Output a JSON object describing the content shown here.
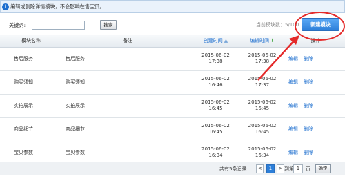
{
  "notice": {
    "icon": "info-icon",
    "text": "编辑或删除详情模块，不会影响在售宝贝。"
  },
  "toolbar": {
    "keyword_label": "关键词:",
    "keyword_value": "",
    "search_label": "搜索",
    "count_text": "当前模块数：5/100",
    "new_label": "新建模块"
  },
  "table": {
    "headers": {
      "name": "模块名称",
      "note": "备注",
      "created": "创建时间",
      "created_sort": "▲",
      "edited": "编辑时间",
      "edited_sort": "⬇",
      "ops": "操作"
    },
    "rows": [
      {
        "name": "售后服务",
        "note": "售后服务",
        "created_date": "2015-06-02",
        "created_time": "17:38",
        "edited_date": "2015-06-02",
        "edited_time": "17:38",
        "edit": "编辑",
        "delete": "删除"
      },
      {
        "name": "购买须知",
        "note": "购买须知",
        "created_date": "2015-06-02",
        "created_time": "16:46",
        "edited_date": "2015-06-02",
        "edited_time": "17:37",
        "edit": "编辑",
        "delete": "删除"
      },
      {
        "name": "实拍展示",
        "note": "实拍展示",
        "created_date": "2015-06-02",
        "created_time": "16:45",
        "edited_date": "2015-06-02",
        "edited_time": "16:45",
        "edit": "编辑",
        "delete": "删除"
      },
      {
        "name": "商品细节",
        "note": "商品细节",
        "created_date": "2015-06-02",
        "created_time": "16:45",
        "edited_date": "2015-06-02",
        "edited_time": "16:45",
        "edit": "编辑",
        "delete": "删除"
      },
      {
        "name": "宝贝参数",
        "note": "宝贝参数",
        "created_date": "2015-06-02",
        "created_time": "16:34",
        "edited_date": "2015-06-02",
        "edited_time": "16:34",
        "edit": "编辑",
        "delete": "删除"
      }
    ]
  },
  "pager": {
    "total_text": "共有5条记录",
    "prev": "<",
    "current": "1",
    "next": ">",
    "goto_label": "到第",
    "page_value": "1",
    "page_unit": "页",
    "confirm_label": "确定"
  },
  "colors": {
    "accent": "#2d7fd9",
    "link": "#1e6fcf",
    "annotation": "#e42a2a"
  }
}
